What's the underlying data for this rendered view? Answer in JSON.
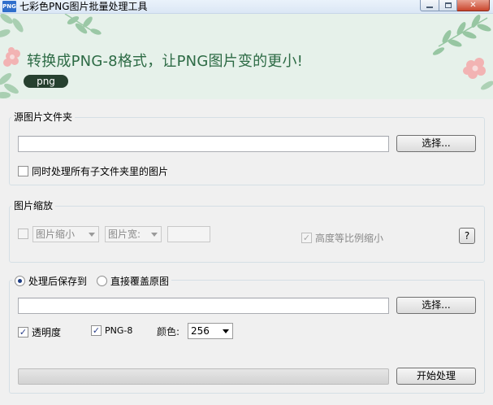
{
  "window": {
    "icon_text": "PNG",
    "title": "七彩色PNG图片批量处理工具",
    "close_glyph": "✕"
  },
  "banner": {
    "slogan": "转换成PNG-8格式，让PNG图片变的更小!",
    "pill": "png",
    "colors": {
      "background": "#e6f1ea",
      "text": "#2d6b45",
      "pill": "#26402f"
    }
  },
  "source": {
    "legend": "源图片文件夹",
    "path_value": "",
    "browse_label": "选择...",
    "subfolders_label": "同时处理所有子文件夹里的图片",
    "subfolders_checked": false
  },
  "scale": {
    "legend": "图片缩放",
    "enabled": false,
    "mode_selected": "图片缩小",
    "dimension_selected": "图片宽:",
    "size_value": "",
    "keep_ratio_label": "高度等比例缩小",
    "keep_ratio_checked": true,
    "help_label": "?"
  },
  "output": {
    "save_to_label": "处理后保存到",
    "overwrite_label": "直接覆盖原图",
    "selected": "save_to",
    "path_value": "",
    "browse_label": "选择...",
    "transparency_label": "透明度",
    "transparency_checked": true,
    "png8_label": "PNG-8",
    "png8_checked": true,
    "colors_label": "颜色:",
    "colors_selected": "256",
    "progress": 0,
    "start_label": "开始处理"
  },
  "icons": {
    "check": "✓"
  }
}
